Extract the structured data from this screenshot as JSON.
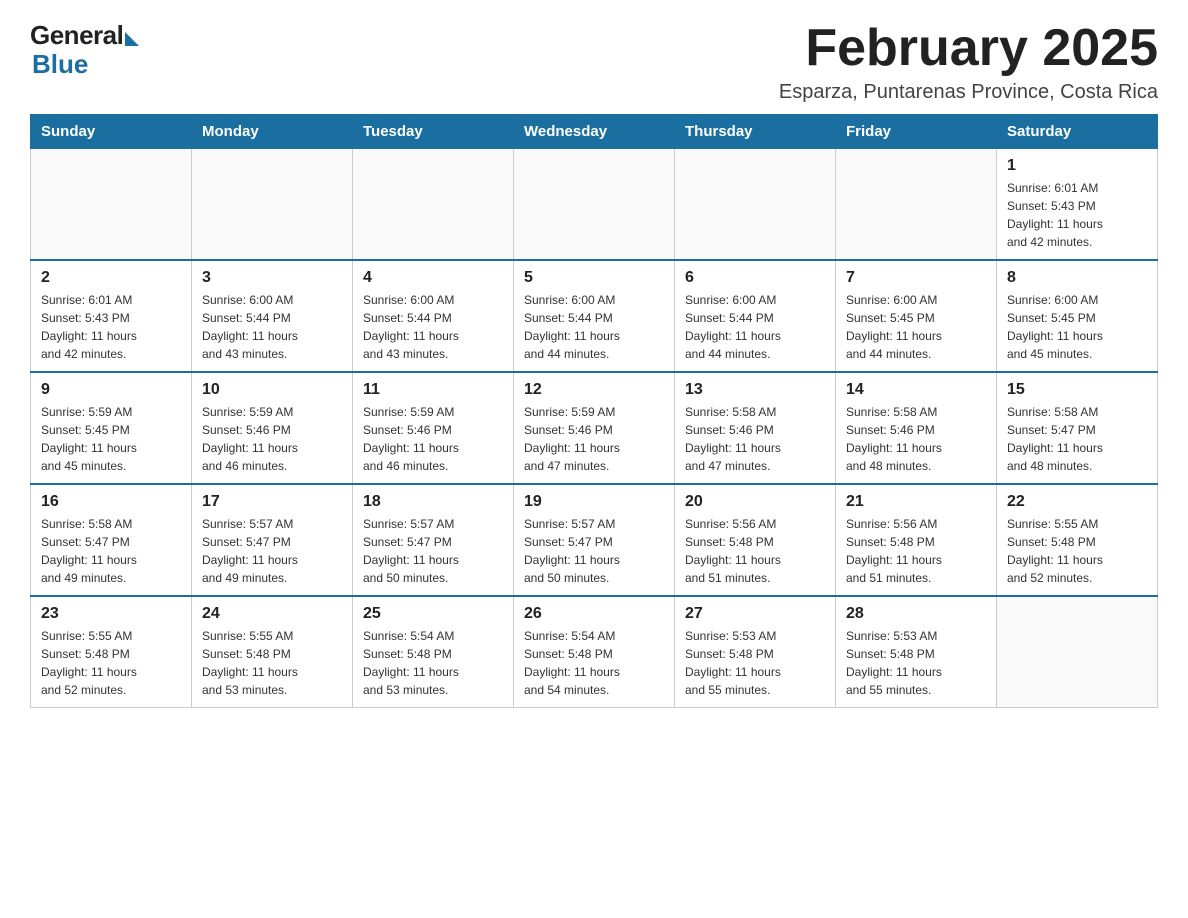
{
  "logo": {
    "general": "General",
    "blue": "Blue"
  },
  "title": "February 2025",
  "location": "Esparza, Puntarenas Province, Costa Rica",
  "days_of_week": [
    "Sunday",
    "Monday",
    "Tuesday",
    "Wednesday",
    "Thursday",
    "Friday",
    "Saturday"
  ],
  "weeks": [
    [
      {
        "day": "",
        "info": ""
      },
      {
        "day": "",
        "info": ""
      },
      {
        "day": "",
        "info": ""
      },
      {
        "day": "",
        "info": ""
      },
      {
        "day": "",
        "info": ""
      },
      {
        "day": "",
        "info": ""
      },
      {
        "day": "1",
        "info": "Sunrise: 6:01 AM\nSunset: 5:43 PM\nDaylight: 11 hours\nand 42 minutes."
      }
    ],
    [
      {
        "day": "2",
        "info": "Sunrise: 6:01 AM\nSunset: 5:43 PM\nDaylight: 11 hours\nand 42 minutes."
      },
      {
        "day": "3",
        "info": "Sunrise: 6:00 AM\nSunset: 5:44 PM\nDaylight: 11 hours\nand 43 minutes."
      },
      {
        "day": "4",
        "info": "Sunrise: 6:00 AM\nSunset: 5:44 PM\nDaylight: 11 hours\nand 43 minutes."
      },
      {
        "day": "5",
        "info": "Sunrise: 6:00 AM\nSunset: 5:44 PM\nDaylight: 11 hours\nand 44 minutes."
      },
      {
        "day": "6",
        "info": "Sunrise: 6:00 AM\nSunset: 5:44 PM\nDaylight: 11 hours\nand 44 minutes."
      },
      {
        "day": "7",
        "info": "Sunrise: 6:00 AM\nSunset: 5:45 PM\nDaylight: 11 hours\nand 44 minutes."
      },
      {
        "day": "8",
        "info": "Sunrise: 6:00 AM\nSunset: 5:45 PM\nDaylight: 11 hours\nand 45 minutes."
      }
    ],
    [
      {
        "day": "9",
        "info": "Sunrise: 5:59 AM\nSunset: 5:45 PM\nDaylight: 11 hours\nand 45 minutes."
      },
      {
        "day": "10",
        "info": "Sunrise: 5:59 AM\nSunset: 5:46 PM\nDaylight: 11 hours\nand 46 minutes."
      },
      {
        "day": "11",
        "info": "Sunrise: 5:59 AM\nSunset: 5:46 PM\nDaylight: 11 hours\nand 46 minutes."
      },
      {
        "day": "12",
        "info": "Sunrise: 5:59 AM\nSunset: 5:46 PM\nDaylight: 11 hours\nand 47 minutes."
      },
      {
        "day": "13",
        "info": "Sunrise: 5:58 AM\nSunset: 5:46 PM\nDaylight: 11 hours\nand 47 minutes."
      },
      {
        "day": "14",
        "info": "Sunrise: 5:58 AM\nSunset: 5:46 PM\nDaylight: 11 hours\nand 48 minutes."
      },
      {
        "day": "15",
        "info": "Sunrise: 5:58 AM\nSunset: 5:47 PM\nDaylight: 11 hours\nand 48 minutes."
      }
    ],
    [
      {
        "day": "16",
        "info": "Sunrise: 5:58 AM\nSunset: 5:47 PM\nDaylight: 11 hours\nand 49 minutes."
      },
      {
        "day": "17",
        "info": "Sunrise: 5:57 AM\nSunset: 5:47 PM\nDaylight: 11 hours\nand 49 minutes."
      },
      {
        "day": "18",
        "info": "Sunrise: 5:57 AM\nSunset: 5:47 PM\nDaylight: 11 hours\nand 50 minutes."
      },
      {
        "day": "19",
        "info": "Sunrise: 5:57 AM\nSunset: 5:47 PM\nDaylight: 11 hours\nand 50 minutes."
      },
      {
        "day": "20",
        "info": "Sunrise: 5:56 AM\nSunset: 5:48 PM\nDaylight: 11 hours\nand 51 minutes."
      },
      {
        "day": "21",
        "info": "Sunrise: 5:56 AM\nSunset: 5:48 PM\nDaylight: 11 hours\nand 51 minutes."
      },
      {
        "day": "22",
        "info": "Sunrise: 5:55 AM\nSunset: 5:48 PM\nDaylight: 11 hours\nand 52 minutes."
      }
    ],
    [
      {
        "day": "23",
        "info": "Sunrise: 5:55 AM\nSunset: 5:48 PM\nDaylight: 11 hours\nand 52 minutes."
      },
      {
        "day": "24",
        "info": "Sunrise: 5:55 AM\nSunset: 5:48 PM\nDaylight: 11 hours\nand 53 minutes."
      },
      {
        "day": "25",
        "info": "Sunrise: 5:54 AM\nSunset: 5:48 PM\nDaylight: 11 hours\nand 53 minutes."
      },
      {
        "day": "26",
        "info": "Sunrise: 5:54 AM\nSunset: 5:48 PM\nDaylight: 11 hours\nand 54 minutes."
      },
      {
        "day": "27",
        "info": "Sunrise: 5:53 AM\nSunset: 5:48 PM\nDaylight: 11 hours\nand 55 minutes."
      },
      {
        "day": "28",
        "info": "Sunrise: 5:53 AM\nSunset: 5:48 PM\nDaylight: 11 hours\nand 55 minutes."
      },
      {
        "day": "",
        "info": ""
      }
    ]
  ]
}
